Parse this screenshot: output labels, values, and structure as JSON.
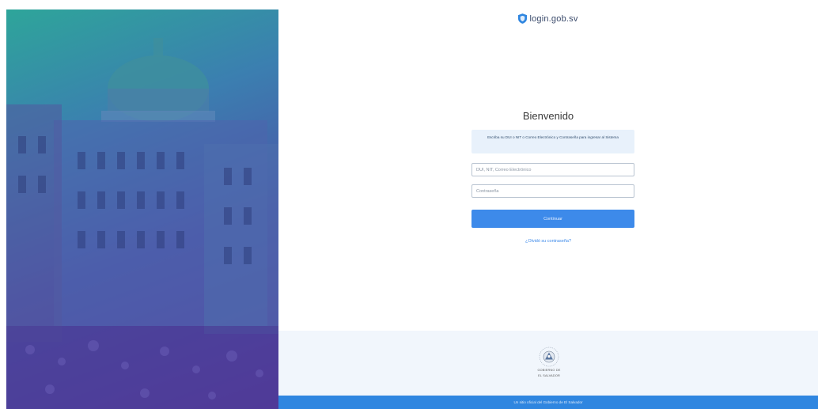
{
  "brand": {
    "icon": "shield-icon",
    "text": "login.gob.sv"
  },
  "login": {
    "title": "Bienvenido",
    "info": "Escriba su DUI o NIT o Correo Electrónico y Contraseña para ingresar al Sistema",
    "user_placeholder": "DUI, NIT, Correo Electrónico",
    "password_placeholder": "Contraseña",
    "submit_label": "Continuar",
    "forgot_link": "¿Olvidó su contraseña?"
  },
  "footer": {
    "seal_icon": "national-seal-icon",
    "seal_text_line1": "GOBIERNO DE",
    "seal_text_line2": "EL SALVADOR",
    "bottom_text": "Un sitio oficial del Gobierno de El Salvador"
  },
  "colors": {
    "accent": "#3d8aea",
    "bottom_bar": "#2f86e0",
    "info_bg": "#e8f1fb",
    "footer_bg": "#f1f6fc",
    "hero_gradient_top": "#2ea59a",
    "hero_gradient_bottom": "#5a3a9e"
  }
}
